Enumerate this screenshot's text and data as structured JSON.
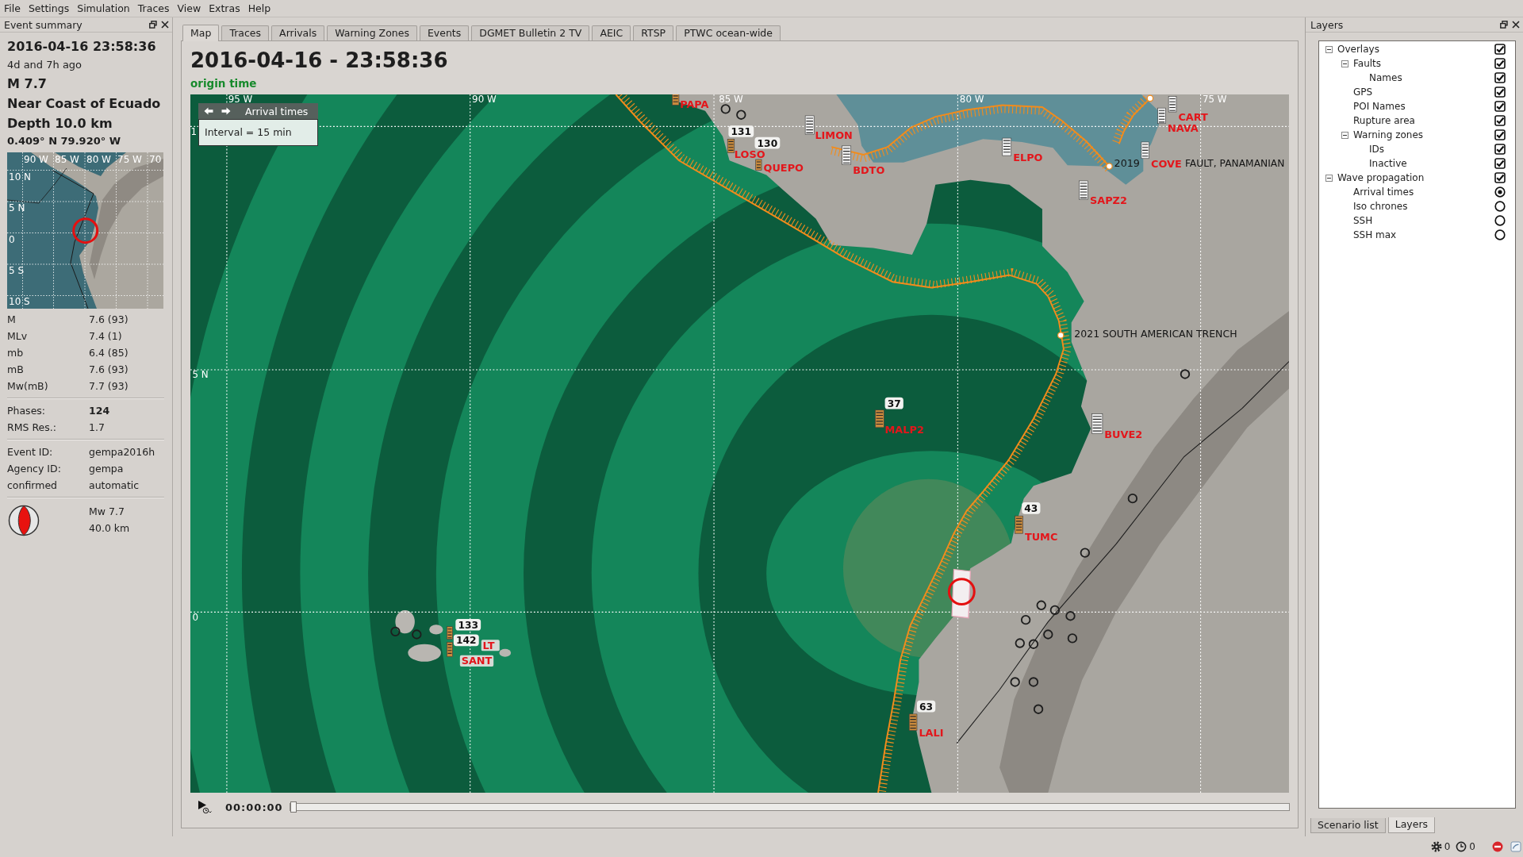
{
  "menu_bar": [
    "File",
    "Settings",
    "Simulation",
    "Traces",
    "View",
    "Extras",
    "Help"
  ],
  "event_summary": {
    "title": "Event summary",
    "time": "2016-04-16 23:58:36",
    "age": "4d and 7h ago",
    "magnitude": "M 7.7",
    "region": "Near Coast of Ecuado",
    "depth": "Depth 10.0 km",
    "location": "0.409° N  79.920° W",
    "minimap": {
      "lon_labels": [
        "90 W",
        "85 W",
        "80 W",
        "75 W",
        "70"
      ],
      "lat_labels": [
        "10 N",
        "5 N",
        "0",
        "5 S",
        "10 S"
      ]
    },
    "magnitudes": [
      {
        "type": "M",
        "value": "7.6 (93)"
      },
      {
        "type": "MLv",
        "value": "7.4 (1)"
      },
      {
        "type": "mb",
        "value": "6.4 (85)"
      },
      {
        "type": "mB",
        "value": "7.6 (93)"
      },
      {
        "type": "Mw(mB)",
        "value": "7.7 (93)"
      }
    ],
    "quality": [
      {
        "label": "Phases:",
        "value": "124",
        "bold": true
      },
      {
        "label": "RMS Res.:",
        "value": "1.7",
        "bold": false
      }
    ],
    "identity": [
      {
        "label": "Event ID:",
        "value": "gempa2016h"
      },
      {
        "label": "Agency ID:",
        "value": "gempa"
      },
      {
        "label": "confirmed",
        "value": "automatic"
      }
    ],
    "focal_mechanism": {
      "magnitude": "Mw 7.7",
      "depth": "40.0 km"
    }
  },
  "tabs": [
    {
      "label": "Map",
      "selected": true
    },
    {
      "label": "Traces",
      "selected": false
    },
    {
      "label": "Arrivals",
      "selected": false
    },
    {
      "label": "Warning Zones",
      "selected": false
    },
    {
      "label": "Events",
      "selected": false
    },
    {
      "label": "DGMET Bulletin 2 TV",
      "selected": false
    },
    {
      "label": "AEIC",
      "selected": false
    },
    {
      "label": "RTSP",
      "selected": false
    },
    {
      "label": "PTWC ocean-wide",
      "selected": false
    }
  ],
  "map_view": {
    "title": "2016-04-16 - 23:58:36",
    "subtitle": "origin time",
    "legend": {
      "title": "Arrival times",
      "text": "Interval = 15 min"
    },
    "grid_labels": [
      "95 W",
      "90 W",
      "85 W",
      "80 W",
      "75 W",
      "1",
      "5 N",
      "0"
    ],
    "fault_labels": [
      "2019",
      "FAULT, PANAMANIAN",
      "2021 SOUTH AMERICAN TRENCH"
    ],
    "stations": [
      {
        "code": "PAPA",
        "color": "#c98a3c"
      },
      {
        "code": "LOSO",
        "color": "#c98a3c",
        "badge": "131"
      },
      {
        "code": "QUEPO",
        "color": "#c98a3c",
        "badge": "130"
      },
      {
        "code": "LIMON",
        "color": "#f2f2f2"
      },
      {
        "code": "BDTO",
        "color": "#f2f2f2"
      },
      {
        "code": "ELPO",
        "color": "#f2f2f2"
      },
      {
        "code": "SAPZ2",
        "color": "#f2f2f2"
      },
      {
        "code": "NAVA",
        "color": "#f2f2f2"
      },
      {
        "code": "CART",
        "color": "#f2f2f2"
      },
      {
        "code": "COVE",
        "color": "#f2f2f2"
      },
      {
        "code": "MALP2",
        "color": "#c98a3c",
        "badge": "37"
      },
      {
        "code": "BUVE2",
        "color": "#f2f2f2"
      },
      {
        "code": "TUMC",
        "color": "#c98a3c",
        "badge": "43"
      },
      {
        "code": "LALI",
        "color": "#c98a3c",
        "badge": "63"
      },
      {
        "code": "LT",
        "color": "#c98a3c",
        "badge": "133"
      },
      {
        "code": "SANT",
        "color": "#c98a3c",
        "badge": "142"
      }
    ],
    "timeline": {
      "time": "00:00:00",
      "level": 0
    }
  },
  "layers": {
    "title": "Layers",
    "tree": [
      {
        "label": "Overlays",
        "kind": "check",
        "checked": true,
        "expanded": true,
        "children": [
          {
            "label": "Faults",
            "kind": "check",
            "checked": true,
            "expanded": true,
            "children": [
              {
                "label": "Names",
                "kind": "check",
                "checked": true
              }
            ]
          },
          {
            "label": "GPS",
            "kind": "check",
            "checked": true
          },
          {
            "label": "POI Names",
            "kind": "check",
            "checked": true
          },
          {
            "label": "Rupture area",
            "kind": "check",
            "checked": true
          },
          {
            "label": "Warning zones",
            "kind": "check",
            "checked": true,
            "expanded": true,
            "children": [
              {
                "label": "IDs",
                "kind": "check",
                "checked": true
              },
              {
                "label": "Inactive",
                "kind": "check",
                "checked": true
              }
            ]
          }
        ]
      },
      {
        "label": "Wave propagation",
        "kind": "check",
        "checked": true,
        "expanded": true,
        "children": [
          {
            "label": "Arrival times",
            "kind": "radio",
            "selected": true
          },
          {
            "label": "Iso chrones",
            "kind": "radio",
            "selected": false
          },
          {
            "label": "SSH",
            "kind": "radio",
            "selected": false
          },
          {
            "label": "SSH max",
            "kind": "radio",
            "selected": false
          }
        ]
      }
    ]
  },
  "dock_tabs": [
    {
      "label": "Scenario list",
      "selected": false
    },
    {
      "label": "Layers",
      "selected": true
    }
  ],
  "status_bar": {
    "counts": [
      "0",
      "0"
    ]
  }
}
